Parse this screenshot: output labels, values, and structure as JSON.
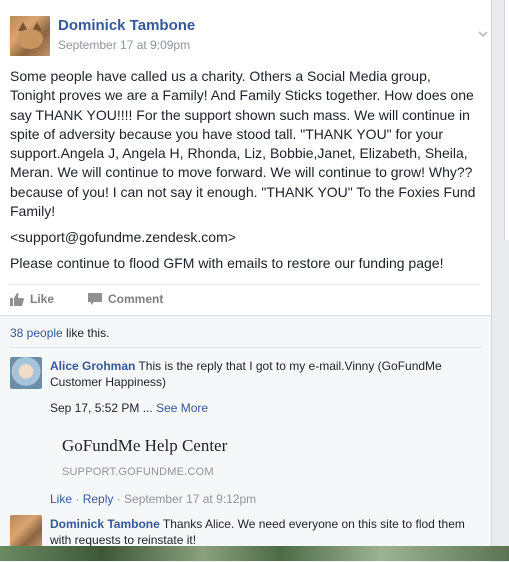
{
  "post": {
    "author": "Dominick Tambone",
    "timestamp": "September 17 at 9:09pm",
    "text": "Some people have called us a charity. Others a Social Media group,\nTonight proves we are a Family! And Family Sticks together. How does one\nsay THANK YOU!!!! For the support shown such mass. We will continue in\nspite of adversity because you have stood tall. \"THANK YOU\" for your\nsupport.Angela J, Angela H, Rhonda, Liz, Bobbie,Janet, Elizabeth, Sheila,\nMeran. We will continue to move forward. We will continue to grow! Why??\nbecause of you! I can not say it enough. \"THANK YOU\" To the Foxies Fund\nFamily!",
    "link_text": "<support@gofundme.zendesk.com>",
    "footer_text": "Please continue to flood GFM with emails to restore our funding page!"
  },
  "actions": {
    "like": "Like",
    "comment": "Comment"
  },
  "likes": {
    "count_link": "38 people",
    "suffix": " like this."
  },
  "comments": [
    {
      "author": "Alice Grohman",
      "text": " This is the reply that I got to my e-mail.Vinny (GoFundMe Customer Happiness)",
      "meta_time": "Sep 17, 5:52 PM ... ",
      "see_more": "See More",
      "preview_title": "GoFundMe Help Center",
      "preview_domain": "SUPPORT.GOFUNDME.COM",
      "like": "Like",
      "sep1": " · ",
      "reply": "Reply",
      "sep2": " · ",
      "time": "September 17 at 9:12pm"
    },
    {
      "author": "Dominick Tambone",
      "text": " Thanks Alice. We need everyone on this site to flod them with requests to reinstate it!"
    }
  ],
  "icons": {
    "chevron": "chevron-down-icon",
    "like": "thumbs-up-icon",
    "comment": "speech-bubble-icon"
  },
  "colors": {
    "link": "#365899",
    "meta": "#90949c",
    "action": "#7f7f7f",
    "background": "#e9ebee"
  }
}
